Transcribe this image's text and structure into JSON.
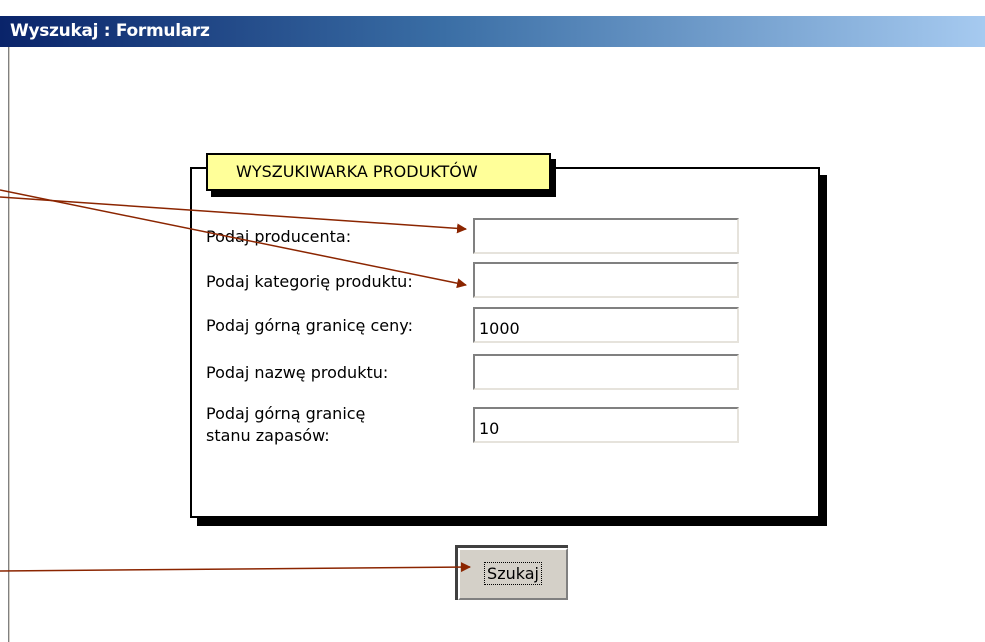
{
  "window": {
    "title": "Wyszukaj : Formularz"
  },
  "group": {
    "title": "WYSZUKIWARKA PRODUKTÓW"
  },
  "fields": {
    "producer": {
      "label": "Podaj producenta:",
      "value": ""
    },
    "category": {
      "label": "Podaj kategorię produktu:",
      "value": ""
    },
    "max_price": {
      "label": "Podaj górną granicę ceny:",
      "value": "1000"
    },
    "product_name": {
      "label": "Podaj nazwę produktu:",
      "value": ""
    },
    "max_stock": {
      "label_line1": "Podaj górną granicę",
      "label_line2": "stanu zapasów:",
      "value": "10"
    }
  },
  "buttons": {
    "search_label": "Szukaj"
  },
  "colors": {
    "title_gradient_start": "#0a246a",
    "title_gradient_end": "#a6caf0",
    "group_tab_bg": "#ffff99",
    "arrow": "#8b2500"
  }
}
